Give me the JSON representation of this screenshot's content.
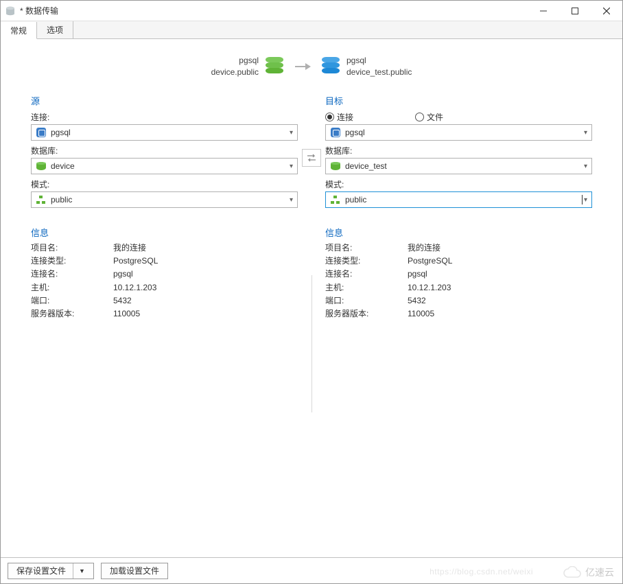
{
  "window": {
    "title": "* 数据传输"
  },
  "tabs": {
    "general": "常规",
    "options": "选项"
  },
  "summary": {
    "source_conn": "pgsql",
    "source_db": "device.public",
    "target_conn": "pgsql",
    "target_db": "device_test.public"
  },
  "source": {
    "heading": "源",
    "conn_label": "连接:",
    "conn_value": "pgsql",
    "db_label": "数据库:",
    "db_value": "device",
    "schema_label": "模式:",
    "schema_value": "public"
  },
  "target": {
    "heading": "目标",
    "radio_conn": "连接",
    "radio_file": "文件",
    "conn_value": "pgsql",
    "db_label": "数据库:",
    "db_value": "device_test",
    "schema_label": "模式:",
    "schema_value": "public"
  },
  "info": {
    "heading": "信息",
    "project_name_k": "项目名:",
    "project_name_v": "我的连接",
    "conn_type_k": "连接类型:",
    "conn_type_v": "PostgreSQL",
    "conn_name_k": "连接名:",
    "conn_name_v": "pgsql",
    "host_k": "主机:",
    "host_v": "10.12.1.203",
    "port_k": "端口:",
    "port_v": "5432",
    "server_ver_k": "服务器版本:",
    "server_ver_v": "110005"
  },
  "footer": {
    "save_profile": "保存设置文件",
    "load_profile": "加载设置文件"
  },
  "watermark": {
    "brand": "亿速云",
    "url": "https://blog.csdn.net/weixi"
  }
}
